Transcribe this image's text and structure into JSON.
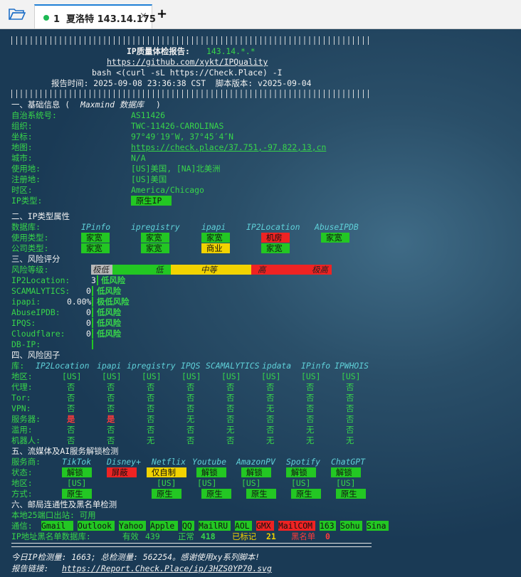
{
  "tabbar": {
    "tab_title": "1  夏洛特 143.14.175",
    "close_icon": "×",
    "new_tab_icon": "+"
  },
  "report": {
    "header_title": "IP质量体检报告: ",
    "header_ip": "143.14.*.*",
    "url": "https://github.com/xykt/IPQuality",
    "command": "bash <(curl -sL https://Check.Place) -I",
    "time_line": "报告时间: 2025-09-08 23:36:38 CST  脚本版本: v2025-09-04",
    "separator": "##########################################################################"
  },
  "basic": {
    "section": "一、基础信息 (Maxmind 数据库)",
    "rows": [
      {
        "k": "自治系统号:",
        "v": "AS11426"
      },
      {
        "k": "组织:",
        "v": "TWC-11426-CAROLINAS"
      },
      {
        "k": "坐标:",
        "v": "97°49′19″W, 37°45′4″N"
      },
      {
        "k": "地图:",
        "v": "https://check.place/37.751,-97.822,13,cn"
      },
      {
        "k": "城市:",
        "v": "N/A"
      },
      {
        "k": "使用地:",
        "v": "[US]美国, [NA]北美洲"
      },
      {
        "k": "注册地:",
        "v": "[US]美国"
      },
      {
        "k": "时区:",
        "v": "America/Chicago"
      },
      {
        "k": "IP类型:",
        "v": " 原生IP "
      }
    ]
  },
  "iptype": {
    "section": "二、IP类型属性",
    "db_label": "数据库:",
    "dbs": [
      "IPinfo",
      "ipregistry",
      "ipapi",
      "IP2Location",
      "AbuseIPDB"
    ],
    "use_label": "使用类型:",
    "use": [
      {
        "t": " 家宽 ",
        "c": "green"
      },
      {
        "t": " 家宽 ",
        "c": "green"
      },
      {
        "t": " 家宽 ",
        "c": "green"
      },
      {
        "t": " 机房 ",
        "c": "red"
      },
      {
        "t": " 家宽 ",
        "c": "green"
      }
    ],
    "org_label": "公司类型:",
    "org": [
      {
        "t": " 家宽 ",
        "c": "green"
      },
      {
        "t": " 家宽 ",
        "c": "green"
      },
      {
        "t": " 商业 ",
        "c": "yellow"
      },
      {
        "t": " 家宽 ",
        "c": "green"
      }
    ]
  },
  "risk": {
    "section": "三、风险评分",
    "level_label": "风险等级:",
    "scale": [
      "极低",
      "低",
      "中等",
      "高",
      "极高"
    ],
    "rows": [
      {
        "k": "IP2Location:",
        "score": "3",
        "verdict": "低风险"
      },
      {
        "k": "SCAMALYTICS:",
        "score": "0",
        "verdict": "低风险"
      },
      {
        "k": "ipapi:",
        "score": "0.00%",
        "verdict": "极低风险"
      },
      {
        "k": "AbuseIPDB:",
        "score": "0",
        "verdict": "低风险"
      },
      {
        "k": "IPQS:",
        "score": "0",
        "verdict": "低风险"
      },
      {
        "k": "Cloudflare:",
        "score": "0",
        "verdict": "低风险"
      },
      {
        "k": "DB-IP:",
        "score": "",
        "verdict": ""
      }
    ]
  },
  "factors": {
    "section": "四、风险因子",
    "lib_label": "库:",
    "libs": [
      "IP2Location",
      "ipapi",
      "ipregistry",
      "IPQS",
      "SCAMALYTICS",
      "ipdata",
      "IPinfo",
      "IPWHOIS"
    ],
    "rows": [
      {
        "k": "地区:",
        "v": [
          "[US]",
          "[US]",
          "[US]",
          "[US]",
          "[US]",
          "[US]",
          "[US]",
          "[US]"
        ]
      },
      {
        "k": "代理:",
        "v": [
          "否",
          "否",
          "否",
          "否",
          "否",
          "否",
          "否",
          "否"
        ]
      },
      {
        "k": "Tor:",
        "v": [
          "否",
          "否",
          "否",
          "否",
          "否",
          "否",
          "否",
          "否"
        ]
      },
      {
        "k": "VPN:",
        "v": [
          "否",
          "否",
          "否",
          "否",
          "否",
          "无",
          "否",
          "否"
        ]
      },
      {
        "k": "服务器:",
        "v": [
          "是",
          "是",
          "否",
          "无",
          "否",
          "否",
          "否",
          "否"
        ]
      },
      {
        "k": "滥用:",
        "v": [
          "否",
          "否",
          "否",
          "否",
          "无",
          "否",
          "无",
          "否"
        ]
      },
      {
        "k": "机器人:",
        "v": [
          "否",
          "否",
          "无",
          "否",
          "否",
          "无",
          "无",
          "无"
        ]
      }
    ]
  },
  "streaming": {
    "section": "五、流媒体及AI服务解锁检测",
    "svc_label": "服务商:",
    "services": [
      "TikTok",
      "Disney+",
      "Netflix",
      "Youtube",
      "AmazonPV",
      "Spotify",
      "ChatGPT"
    ],
    "status_label": "状态:",
    "status": [
      {
        "t": " 解锁 ",
        "c": "green"
      },
      {
        "t": " 屏蔽 ",
        "c": "red"
      },
      {
        "t": " 仅自制 ",
        "c": "yellow"
      },
      {
        "t": " 解锁 ",
        "c": "green"
      },
      {
        "t": " 解锁 ",
        "c": "green"
      },
      {
        "t": " 解锁 ",
        "c": "green"
      },
      {
        "t": " 解锁 ",
        "c": "green"
      }
    ],
    "region_label": "地区:",
    "region": [
      "[US]",
      "",
      "[US]",
      "[US]",
      "[US]",
      "[US]",
      "[US]"
    ],
    "mode_label": "方式:",
    "mode": [
      " 原生 ",
      "",
      " 原生 ",
      " 原生 ",
      " 原生 ",
      " 原生 ",
      " 原生 "
    ]
  },
  "mail": {
    "section": "六、邮局连通性及黑名单检测",
    "port25": "本地25端口出站: 可用",
    "comm_label": "通信:",
    "providers": [
      {
        "t": "Gmail",
        "c": "green"
      },
      {
        "t": "Outlook",
        "c": "green"
      },
      {
        "t": "Yahoo",
        "c": "green"
      },
      {
        "t": "Apple",
        "c": "green"
      },
      {
        "t": "QQ",
        "c": "green"
      },
      {
        "t": "MailRU",
        "c": "green"
      },
      {
        "t": "AOL",
        "c": "green"
      },
      {
        "t": "GMX",
        "c": "red"
      },
      {
        "t": "MailCOM",
        "c": "red"
      },
      {
        "t": "163",
        "c": "green"
      },
      {
        "t": "Sohu",
        "c": "green"
      },
      {
        "t": "Sina",
        "c": "green"
      }
    ],
    "bl_label": "IP地址黑名单数据库:",
    "valid_label": "有效",
    "valid": "439",
    "normal_label": "正常",
    "normal": "418",
    "marked_label": "已标记",
    "marked": "21",
    "black_label": "黑名单",
    "black": "0"
  },
  "footer": {
    "stats": "今日IP检测量: 1663; 总检测量: 562254。感谢使用xy系列脚本!",
    "link_label": "报告链接: ",
    "link": "https://Report.Check.Place/ip/3HZS0YP70.svg"
  },
  "colors": {
    "green": "#23c723",
    "red": "#ee2323",
    "yellow": "#f2d300",
    "text_green": "#38d54a",
    "text_cyan": "#5fd0d8"
  }
}
